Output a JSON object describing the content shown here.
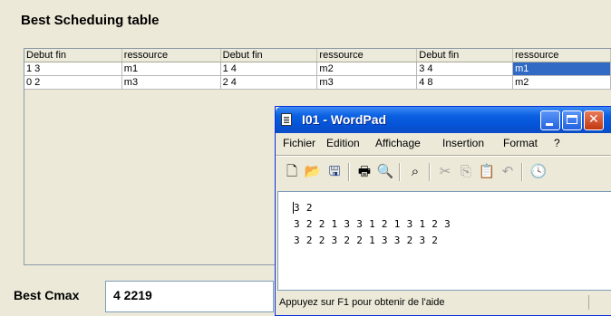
{
  "title": "Best Scheduing table",
  "table": {
    "headers": [
      "Debut fin",
      "ressource",
      "Debut fin",
      "ressource",
      "Debut fin",
      "ressource"
    ],
    "rows": [
      [
        "1 3",
        "m1",
        "1 4",
        "m2",
        "3 4",
        "m1"
      ],
      [
        "0 2",
        "m3",
        "2 4",
        "m3",
        "4 8",
        "m2"
      ]
    ],
    "selected_cell": {
      "row": 0,
      "col": 5
    }
  },
  "cmax": {
    "label": "Best Cmax",
    "value": "4 2219"
  },
  "wordpad": {
    "title": "I01 - WordPad",
    "menu": [
      "Fichier",
      "Edition",
      "Affichage",
      "Insertion",
      "Format",
      "?"
    ],
    "toolbar_icons": [
      "new-icon",
      "open-icon",
      "save-icon",
      "print-icon",
      "print-preview-icon",
      "find-icon",
      "cut-icon",
      "copy-icon",
      "paste-icon",
      "undo-icon",
      "date-time-icon"
    ],
    "document_lines": [
      "3 2",
      "3 2 2 1 3 3 1 2 1 3 1 2 3",
      "3 2 2 3 2 2 1 3 3 2 3 2"
    ],
    "status": "Appuyez sur F1 pour obtenir de l'aide"
  }
}
